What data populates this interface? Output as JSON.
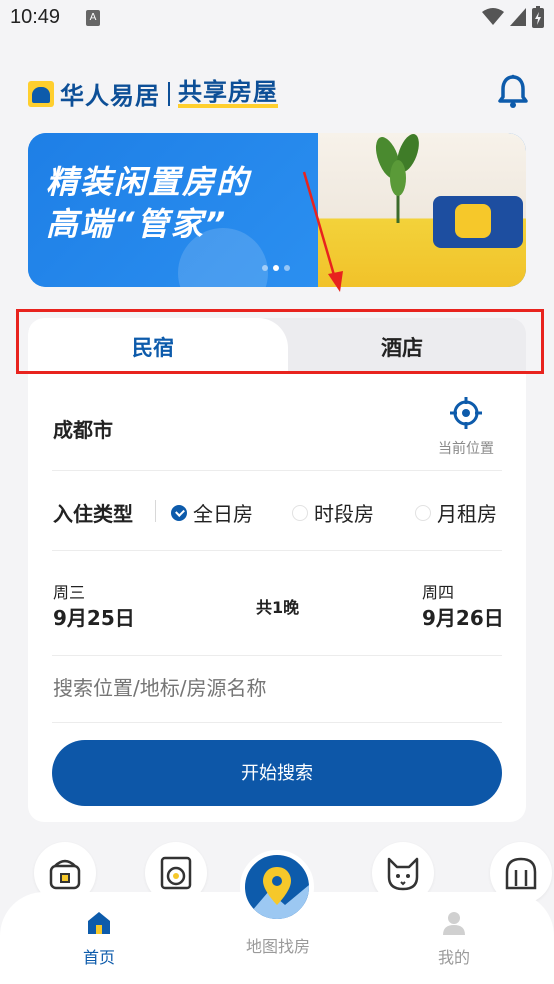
{
  "status_bar": {
    "time": "10:49",
    "notification_badge": "A"
  },
  "header": {
    "logo_text": "华人易居",
    "logo_sub": "共享房屋",
    "accent": "#0d4f97",
    "brand_yellow": "#ffcf2e"
  },
  "banner": {
    "title_line1": "精装闲置房的",
    "title_line2": "高端“管家”",
    "dots": 3,
    "active_dot": 1
  },
  "tabs": [
    {
      "label": "民宿",
      "active": true
    },
    {
      "label": "酒店",
      "active": false
    }
  ],
  "search": {
    "city": "成都市",
    "locate_label": "当前位置",
    "type_label": "入住类型",
    "options": [
      {
        "label": "全日房",
        "checked": true
      },
      {
        "label": "时段房",
        "checked": false
      },
      {
        "label": "月租房",
        "checked": false
      }
    ],
    "checkin": {
      "weekday": "周三",
      "date": "9月25日"
    },
    "nights": "共1晚",
    "checkout": {
      "weekday": "周四",
      "date": "9月26日"
    },
    "placeholder": "搜索位置/地标/房源名称",
    "button_label": "开始搜索"
  },
  "quick_icons": [
    "rice-cooker-icon",
    "washing-machine-icon",
    "pet-icon",
    "tunnel-icon"
  ],
  "bottom_nav": {
    "home_label": "首页",
    "map_label": "地图找房",
    "profile_label": "我的",
    "active": "home"
  },
  "colors": {
    "primary": "#0d57a8",
    "highlight_frame": "#e8231e"
  }
}
